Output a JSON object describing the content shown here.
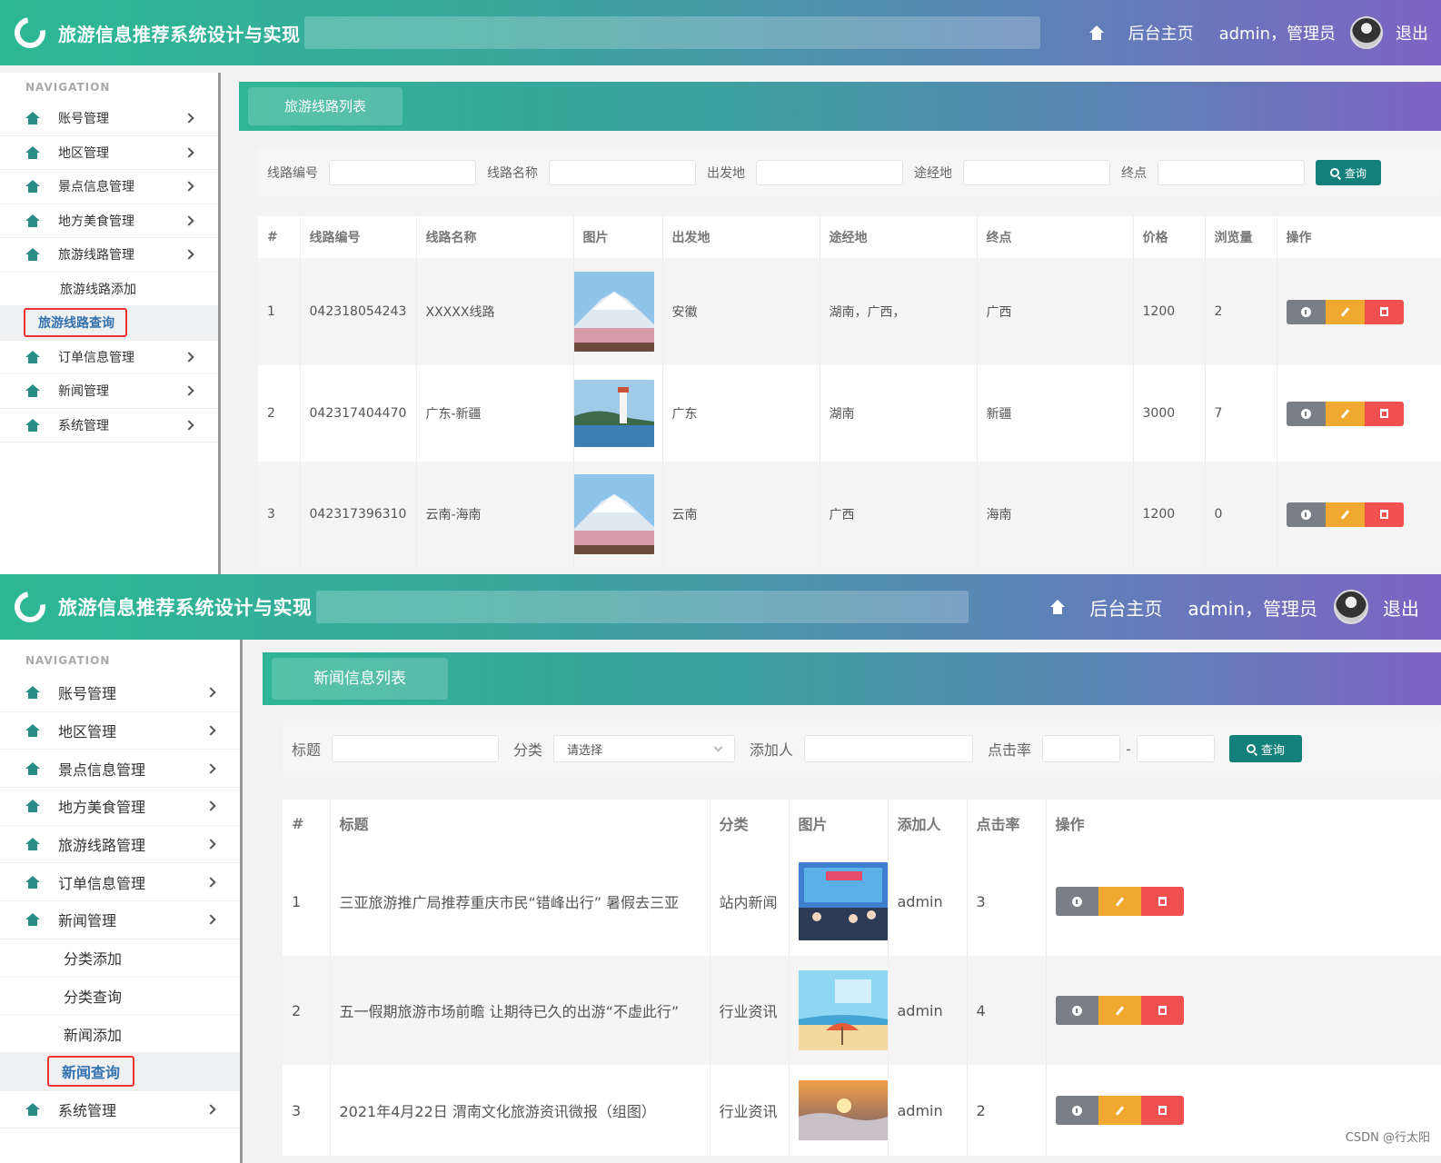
{
  "app_title": "旅游信息推荐系统设计与实现",
  "header": {
    "home_label": "后台主页",
    "user_label": "admin，管理员",
    "logout_label": "退出"
  },
  "nav_caption": "NAVIGATION",
  "top": {
    "sidebar": [
      {
        "label": "账号管理"
      },
      {
        "label": "地区管理"
      },
      {
        "label": "景点信息管理"
      },
      {
        "label": "地方美食管理"
      },
      {
        "label": "旅游线路管理"
      }
    ],
    "sub_items": [
      "旅游线路添加",
      "旅游线路查询"
    ],
    "sidebar_after": [
      {
        "label": "订单信息管理"
      },
      {
        "label": "新闻管理"
      },
      {
        "label": "系统管理"
      }
    ],
    "section_title": "旅游线路列表",
    "search": {
      "route_no": "线路编号",
      "route_name": "线路名称",
      "origin": "出发地",
      "via": "途经地",
      "destination": "终点",
      "button": "查询"
    },
    "columns": [
      "#",
      "线路编号",
      "线路名称",
      "图片",
      "出发地",
      "途经地",
      "终点",
      "价格",
      "浏览量",
      "操作"
    ],
    "rows": [
      {
        "idx": "1",
        "no": "042318054243",
        "name": "XXXXX线路",
        "image": "mountain-blossom",
        "origin": "安徽",
        "via": "湖南，广西，",
        "dest": "广西",
        "price": "1200",
        "views": "2"
      },
      {
        "idx": "2",
        "no": "042317404470",
        "name": "广东-新疆",
        "image": "lighthouse",
        "origin": "广东",
        "via": "湖南",
        "dest": "新疆",
        "price": "3000",
        "views": "7"
      },
      {
        "idx": "3",
        "no": "042317396310",
        "name": "云南-海南",
        "image": "mountain-blossom",
        "origin": "云南",
        "via": "广西",
        "dest": "海南",
        "price": "1200",
        "views": "0"
      }
    ]
  },
  "bottom": {
    "sidebar": [
      {
        "label": "账号管理"
      },
      {
        "label": "地区管理"
      },
      {
        "label": "景点信息管理"
      },
      {
        "label": "地方美食管理"
      },
      {
        "label": "旅游线路管理"
      },
      {
        "label": "订单信息管理"
      },
      {
        "label": "新闻管理"
      }
    ],
    "sub_items": [
      "分类添加",
      "分类查询",
      "新闻添加",
      "新闻查询"
    ],
    "sidebar_after": [
      {
        "label": "系统管理"
      }
    ],
    "section_title": "新闻信息列表",
    "search": {
      "title": "标题",
      "category": "分类",
      "category_placeholder": "请选择",
      "adder": "添加人",
      "click_rate": "点击率",
      "dash": "-",
      "button": "查询"
    },
    "columns": [
      "#",
      "标题",
      "分类",
      "图片",
      "添加人",
      "点击率",
      "操作"
    ],
    "rows": [
      {
        "idx": "1",
        "title": "三亚旅游推广局推荐重庆市民“错峰出行” 暑假去三亚",
        "category": "站内新闻",
        "image": "event-stage",
        "adder": "admin",
        "rate": "3"
      },
      {
        "idx": "2",
        "title": "五一假期旅游市场前瞻 让期待已久的出游“不虚此行”",
        "category": "行业资讯",
        "image": "beach-holiday",
        "adder": "admin",
        "rate": "4"
      },
      {
        "idx": "3",
        "title": "2021年4月22日 渭南文化旅游资讯微报（组图）",
        "category": "行业资讯",
        "image": "sunset-clouds",
        "adder": "admin",
        "rate": "2"
      }
    ]
  },
  "watermark": "CSDN @行太阳",
  "colors": {
    "header_start": "#2bb894",
    "header_end": "#7d64c3",
    "query_button": "#13807c",
    "info": "#7a7f86",
    "edit": "#f0a830",
    "delete": "#f05050",
    "nav_icon": "#2a8c86",
    "highlight_border": "#e33333"
  }
}
